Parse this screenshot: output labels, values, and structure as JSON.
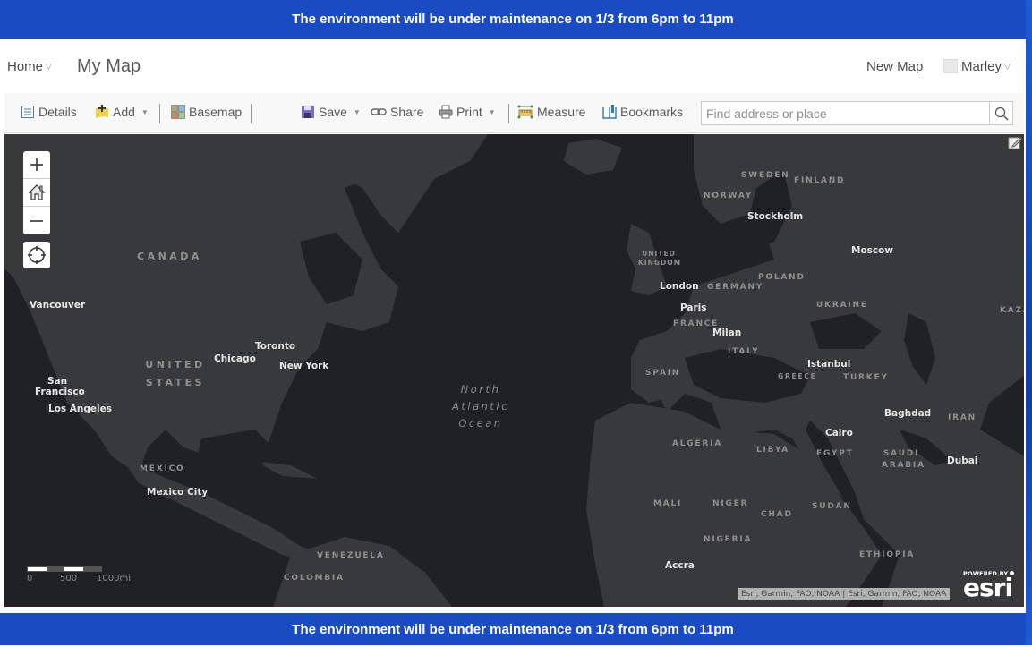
{
  "banner": {
    "top_text": "The environment will be under maintenance on 1/3 from 6pm to 11pm",
    "bottom_text": "The environment will be under maintenance on 1/3 from 6pm to 11pm",
    "color": "#1b4bc2"
  },
  "header": {
    "home_label": "Home",
    "map_title": "My Map",
    "new_map_label": "New Map",
    "user_name": "Marley"
  },
  "toolbar": {
    "details": "Details",
    "add": "Add",
    "basemap": "Basemap",
    "save": "Save",
    "share": "Share",
    "print": "Print",
    "measure": "Measure",
    "bookmarks": "Bookmarks",
    "search_placeholder": "Find address or place",
    "search_value": ""
  },
  "map": {
    "controls": {
      "zoom_in": "+",
      "zoom_out": "−"
    },
    "labels": {
      "cities": [
        "Vancouver",
        "San Francisco",
        "Los Angeles",
        "Chicago",
        "Toronto",
        "New York",
        "Mexico City",
        "London",
        "Paris",
        "Milan",
        "Stockholm",
        "Moscow",
        "Istanbul",
        "Cairo",
        "Baghdad",
        "Dubai",
        "Accra"
      ],
      "countries": [
        "CANADA",
        "UNITED STATES",
        "MÉXICO",
        "VENEZUELA",
        "COLOMBIA",
        "UNITED KINGDOM",
        "GERMANY",
        "FRANCE",
        "SPAIN",
        "ITALY",
        "POLAND",
        "UKRAINE",
        "NORWAY",
        "SWEDEN",
        "FINLAND",
        "GREECE",
        "TURKEY",
        "IRAN",
        "KAZA",
        "ALGERIA",
        "LIBYA",
        "EGYPT",
        "SAUDI ARABIA",
        "MALI",
        "NIGER",
        "CHAD",
        "SUDAN",
        "NIGERIA",
        "ETHIOPIA"
      ],
      "ocean": [
        "North",
        "Atlantic",
        "Ocean"
      ]
    },
    "scale": {
      "ticks": [
        "0",
        "500",
        "1000mi"
      ]
    },
    "attribution": "Esri, Garmin, FAO, NOAA | Esri, Garmin, FAO, NOAA",
    "powered_by": "POWERED BY",
    "esri_logo": "esri",
    "land_color": "#38393b",
    "water_color": "#1f2125"
  }
}
